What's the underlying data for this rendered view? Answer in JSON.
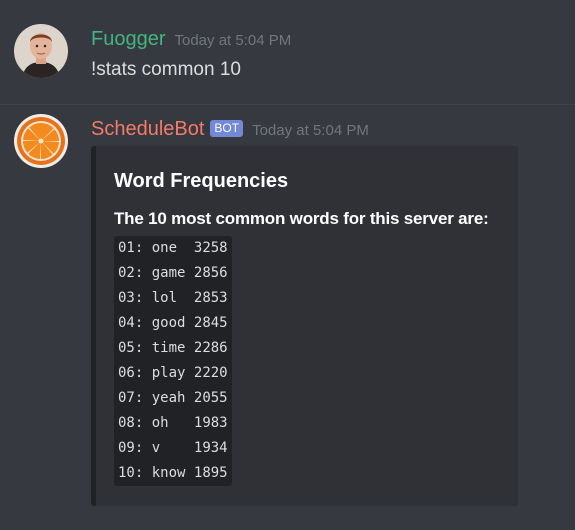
{
  "messages": [
    {
      "username": "Fuogger",
      "timestamp": "Today at 5:04 PM",
      "text": "!stats common 10",
      "name_color": "#43b581"
    },
    {
      "username": "ScheduleBot",
      "bot_tag": "BOT",
      "timestamp": "Today at 5:04 PM",
      "name_color": "#f47b67",
      "embed": {
        "title": "Word Frequencies",
        "field_name": "The 10 most common words for this server are:",
        "rows": [
          {
            "rank": "01:",
            "word": "one ",
            "count": "3258"
          },
          {
            "rank": "02:",
            "word": "game",
            "count": "2856"
          },
          {
            "rank": "03:",
            "word": "lol ",
            "count": "2853"
          },
          {
            "rank": "04:",
            "word": "good",
            "count": "2845"
          },
          {
            "rank": "05:",
            "word": "time",
            "count": "2286"
          },
          {
            "rank": "06:",
            "word": "play",
            "count": "2220"
          },
          {
            "rank": "07:",
            "word": "yeah",
            "count": "2055"
          },
          {
            "rank": "08:",
            "word": "oh  ",
            "count": "1983"
          },
          {
            "rank": "09:",
            "word": "v   ",
            "count": "1934"
          },
          {
            "rank": "10:",
            "word": "know",
            "count": "1895"
          }
        ]
      }
    }
  ]
}
